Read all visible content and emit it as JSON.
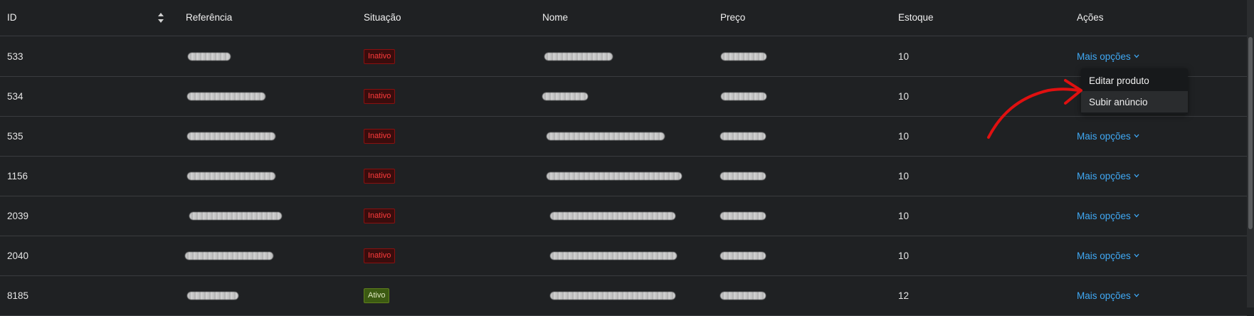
{
  "columns": {
    "id": "ID",
    "referencia": "Referência",
    "situacao": "Situação",
    "nome": "Nome",
    "preco": "Preço",
    "estoque": "Estoque",
    "acoes": "Ações"
  },
  "rows": [
    {
      "id": "533",
      "status": "Inativo",
      "status_type": "inativo",
      "estoque": "10",
      "acao": "Mais opções"
    },
    {
      "id": "534",
      "status": "Inativo",
      "status_type": "inativo",
      "estoque": "10",
      "acao": ""
    },
    {
      "id": "535",
      "status": "Inativo",
      "status_type": "inativo",
      "estoque": "10",
      "acao": "Mais opções"
    },
    {
      "id": "1156",
      "status": "Inativo",
      "status_type": "inativo",
      "estoque": "10",
      "acao": "Mais opções"
    },
    {
      "id": "2039",
      "status": "Inativo",
      "status_type": "inativo",
      "estoque": "10",
      "acao": "Mais opções"
    },
    {
      "id": "2040",
      "status": "Inativo",
      "status_type": "inativo",
      "estoque": "10",
      "acao": "Mais opções"
    },
    {
      "id": "8185",
      "status": "Ativo",
      "status_type": "ativo",
      "estoque": "12",
      "acao": "Mais opções"
    }
  ],
  "dropdown": {
    "items": [
      "Editar produto",
      "Subir anúncio"
    ],
    "hovered_index": 1
  },
  "colors": {
    "link": "#3fa9f5",
    "inactive": "#ff3b3b",
    "active": "#3c5a12",
    "annotation_arrow": "#e01010"
  },
  "icons": {
    "sort": "sort-icon",
    "chevron": "chevron-down-icon",
    "annotation": "red-arrow-annotation"
  }
}
